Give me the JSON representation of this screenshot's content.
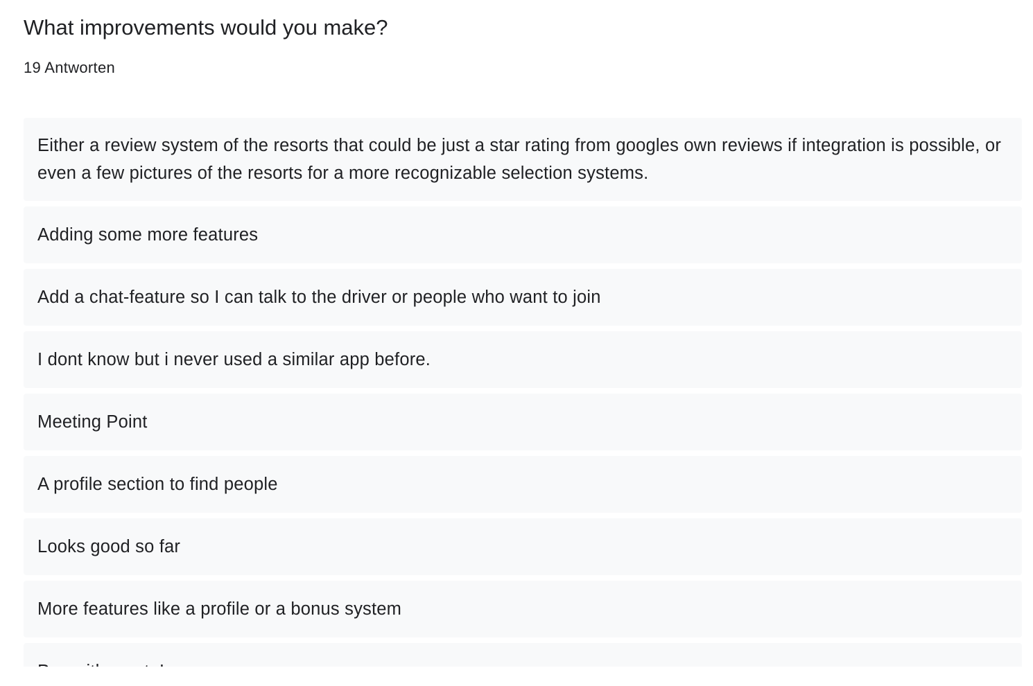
{
  "question": {
    "title": "What improvements would you make?",
    "response_count": "19 Antworten"
  },
  "responses": [
    "Either a review system of the resorts that could be just a star rating from googles own reviews if integration is possible, or even a few pictures of the resorts for a more recognizable selection systems.",
    "Adding some more features",
    "Add a chat-feature so I can talk to the driver or people who want to join",
    "I dont know but i never used a similar app before.",
    "Meeting Point",
    "A profile section to find people",
    "Looks good so far",
    "More features like a profile or a bonus system",
    "Pay with crypto!"
  ],
  "colors": {
    "text": "#202124",
    "response_background": "#f8f9fa",
    "page_background": "#ffffff"
  }
}
